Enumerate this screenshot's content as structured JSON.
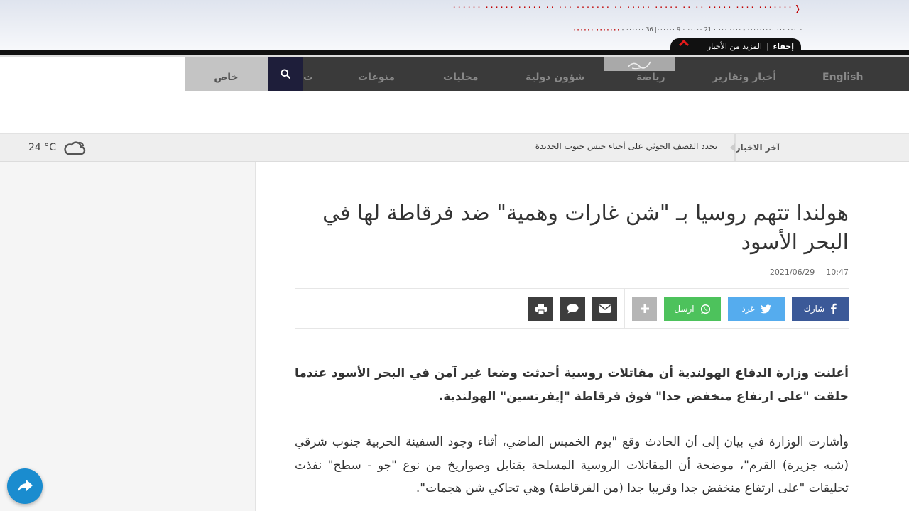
{
  "banner": {
    "headline": "٠٠٠٠٠٠٠ ٠٠٠٠ ٠٠٠٠٠ ٠٠ ٠٠ ٠٠٠٠٠ ٠٠٠٠٠ ٠٠ ٠٠٠٠٠٠٠ ٠٠٠ ٠٠ ٠٠٠٠٠ ٠٠٠٠٠٠ ٠٠٠٠٠٠",
    "meta_text": "٠٠٠٠٠ ٠٠٠ ٠٠٠٠٠٠٠٠٠ - ٠٠٠٠ ٠٠٠ ٠ 21 ٠٠٠٠٠ ٠ 9 ٠٠٠٠٠٠| 36 ٠٠٠٠٠٠ -",
    "meta_red": "٠٠٠٠٠٠٠ ٠٠٠٠٠٠",
    "hide_label": "إخفاء",
    "more_news_label": "المزيد من الأخبار",
    "accent_color": "#c00000"
  },
  "nav": {
    "special_label": "خاص",
    "items": [
      {
        "label": "English"
      },
      {
        "label": "أخبار وتقارير"
      },
      {
        "label": "رياضة"
      },
      {
        "label": "شؤون دولية"
      },
      {
        "label": "محليات"
      },
      {
        "label": "منوعات"
      },
      {
        "label": "ت"
      }
    ]
  },
  "ticker": {
    "label": "آخر الاخبار",
    "headline": "تجدد القصف الحوثي على أحياء جيس جنوب الحديدة"
  },
  "weather": {
    "temperature": "24 °C",
    "icon": "cloud-icon"
  },
  "article": {
    "title": "هولندا تتهم روسيا بـ \"شن غارات وهمية\" ضد فرقاطة لها في البحر الأسود",
    "date": "2021/06/29",
    "time": "10:47",
    "paragraphs": [
      "أعلنت وزارة الدفاع الهولندية أن مقاتلات روسية أحدثت وضعا غير آمن في البحر الأسود عندما حلقت \"على ارتفاع منخفض جدا\" فوق فرقاطة \"إيفرتسين\" الهولندية.",
      "وأشارت الوزارة في بيان إلى أن الحادث وقع \"يوم الخميس الماضي، أثناء وجود السفينة الحربية جنوب شرقي (شبه جزيرة) القرم\"، موضحة أن المقاتلات الروسية المسلحة بقنابل وصواريخ من نوع \"جو - سطح\" نفذت تحليقات \"على ارتفاع منخفض جدا وقريبا جدا (من الفرقاطة) وهي تحاكي شن هجمات\"."
    ]
  },
  "share": {
    "facebook_label": "شارك",
    "twitter_label": "غرد",
    "whatsapp_label": "ارسل",
    "facebook_color": "#3b5998",
    "twitter_color": "#55acee",
    "whatsapp_color": "#4dc25c",
    "more_color": "#b5b5b5",
    "icon_color": "#3d3d3d"
  }
}
